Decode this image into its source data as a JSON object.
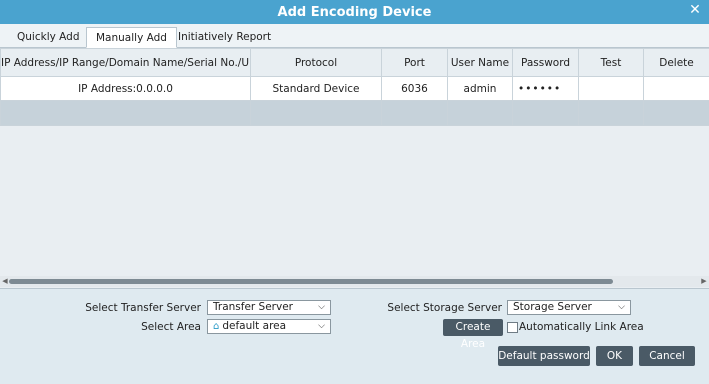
{
  "window": {
    "title": "Add Encoding Device"
  },
  "tabs": [
    {
      "label": "Quickly Add"
    },
    {
      "label": "Manually Add"
    },
    {
      "label": "Initiatively Report"
    }
  ],
  "table": {
    "columns": [
      "IP Address/IP Range/Domain Name/Serial No./URL",
      "Protocol",
      "Port",
      "User Name",
      "Password",
      "Test",
      "Delete"
    ],
    "rows": [
      {
        "address": "IP Address:0.0.0.0",
        "protocol": "Standard Device",
        "port": "6036",
        "username": "admin",
        "password": "••••••",
        "test": "",
        "delete": ""
      }
    ]
  },
  "form": {
    "transfer_label": "Select Transfer Server",
    "transfer_value": "Transfer Server",
    "storage_label": "Select Storage Server",
    "storage_value": "Storage Server",
    "area_label": "Select Area",
    "area_value": "default area",
    "create_area_label": "Create Area",
    "auto_link_label": "Automatically Link Area",
    "auto_link_checked": false
  },
  "buttons": {
    "default_password": "Default password",
    "ok": "OK",
    "cancel": "Cancel"
  },
  "colors": {
    "title_bar": "#4aa3cf",
    "button": "#4a5a66",
    "area_icon": "#2a9bc7"
  },
  "icons": {
    "close": "close-icon",
    "dropdown": "chevron-down-icon",
    "area": "home-icon"
  }
}
